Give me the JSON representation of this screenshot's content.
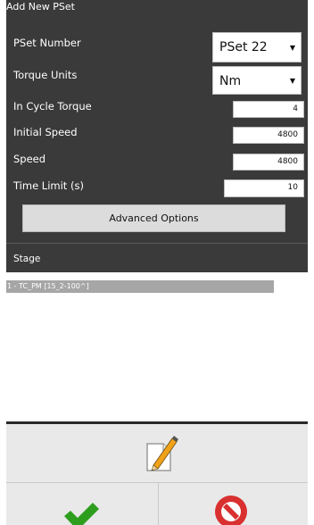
{
  "dialog": {
    "title": "Add New PSet"
  },
  "fields": {
    "pset_number": {
      "label": "PSet Number",
      "value": "PSet 22"
    },
    "torque_units": {
      "label": "Torque Units",
      "value": "Nm"
    },
    "in_cycle_torque": {
      "label": "In Cycle Torque",
      "value": "4"
    },
    "initial_speed": {
      "label": "Initial Speed",
      "value": "4800"
    },
    "speed": {
      "label": "Speed",
      "value": "4800"
    },
    "time_limit": {
      "label": "Time Limit (s)",
      "value": "10"
    }
  },
  "advanced_options": {
    "label": "Advanced Options"
  },
  "stage": {
    "header": "Stage",
    "items": [
      "1 - TC_PM [15_2-100^]"
    ]
  },
  "icons": {
    "edit": "pencil-edit-icon",
    "confirm": "green-checkmark-icon",
    "cancel": "red-no-entry-icon"
  },
  "colors": {
    "panel_bg": "#3a3a3a",
    "selected_row": "#a6a6a6",
    "confirm_green": "#2e9e1f",
    "cancel_red": "#d93030"
  }
}
